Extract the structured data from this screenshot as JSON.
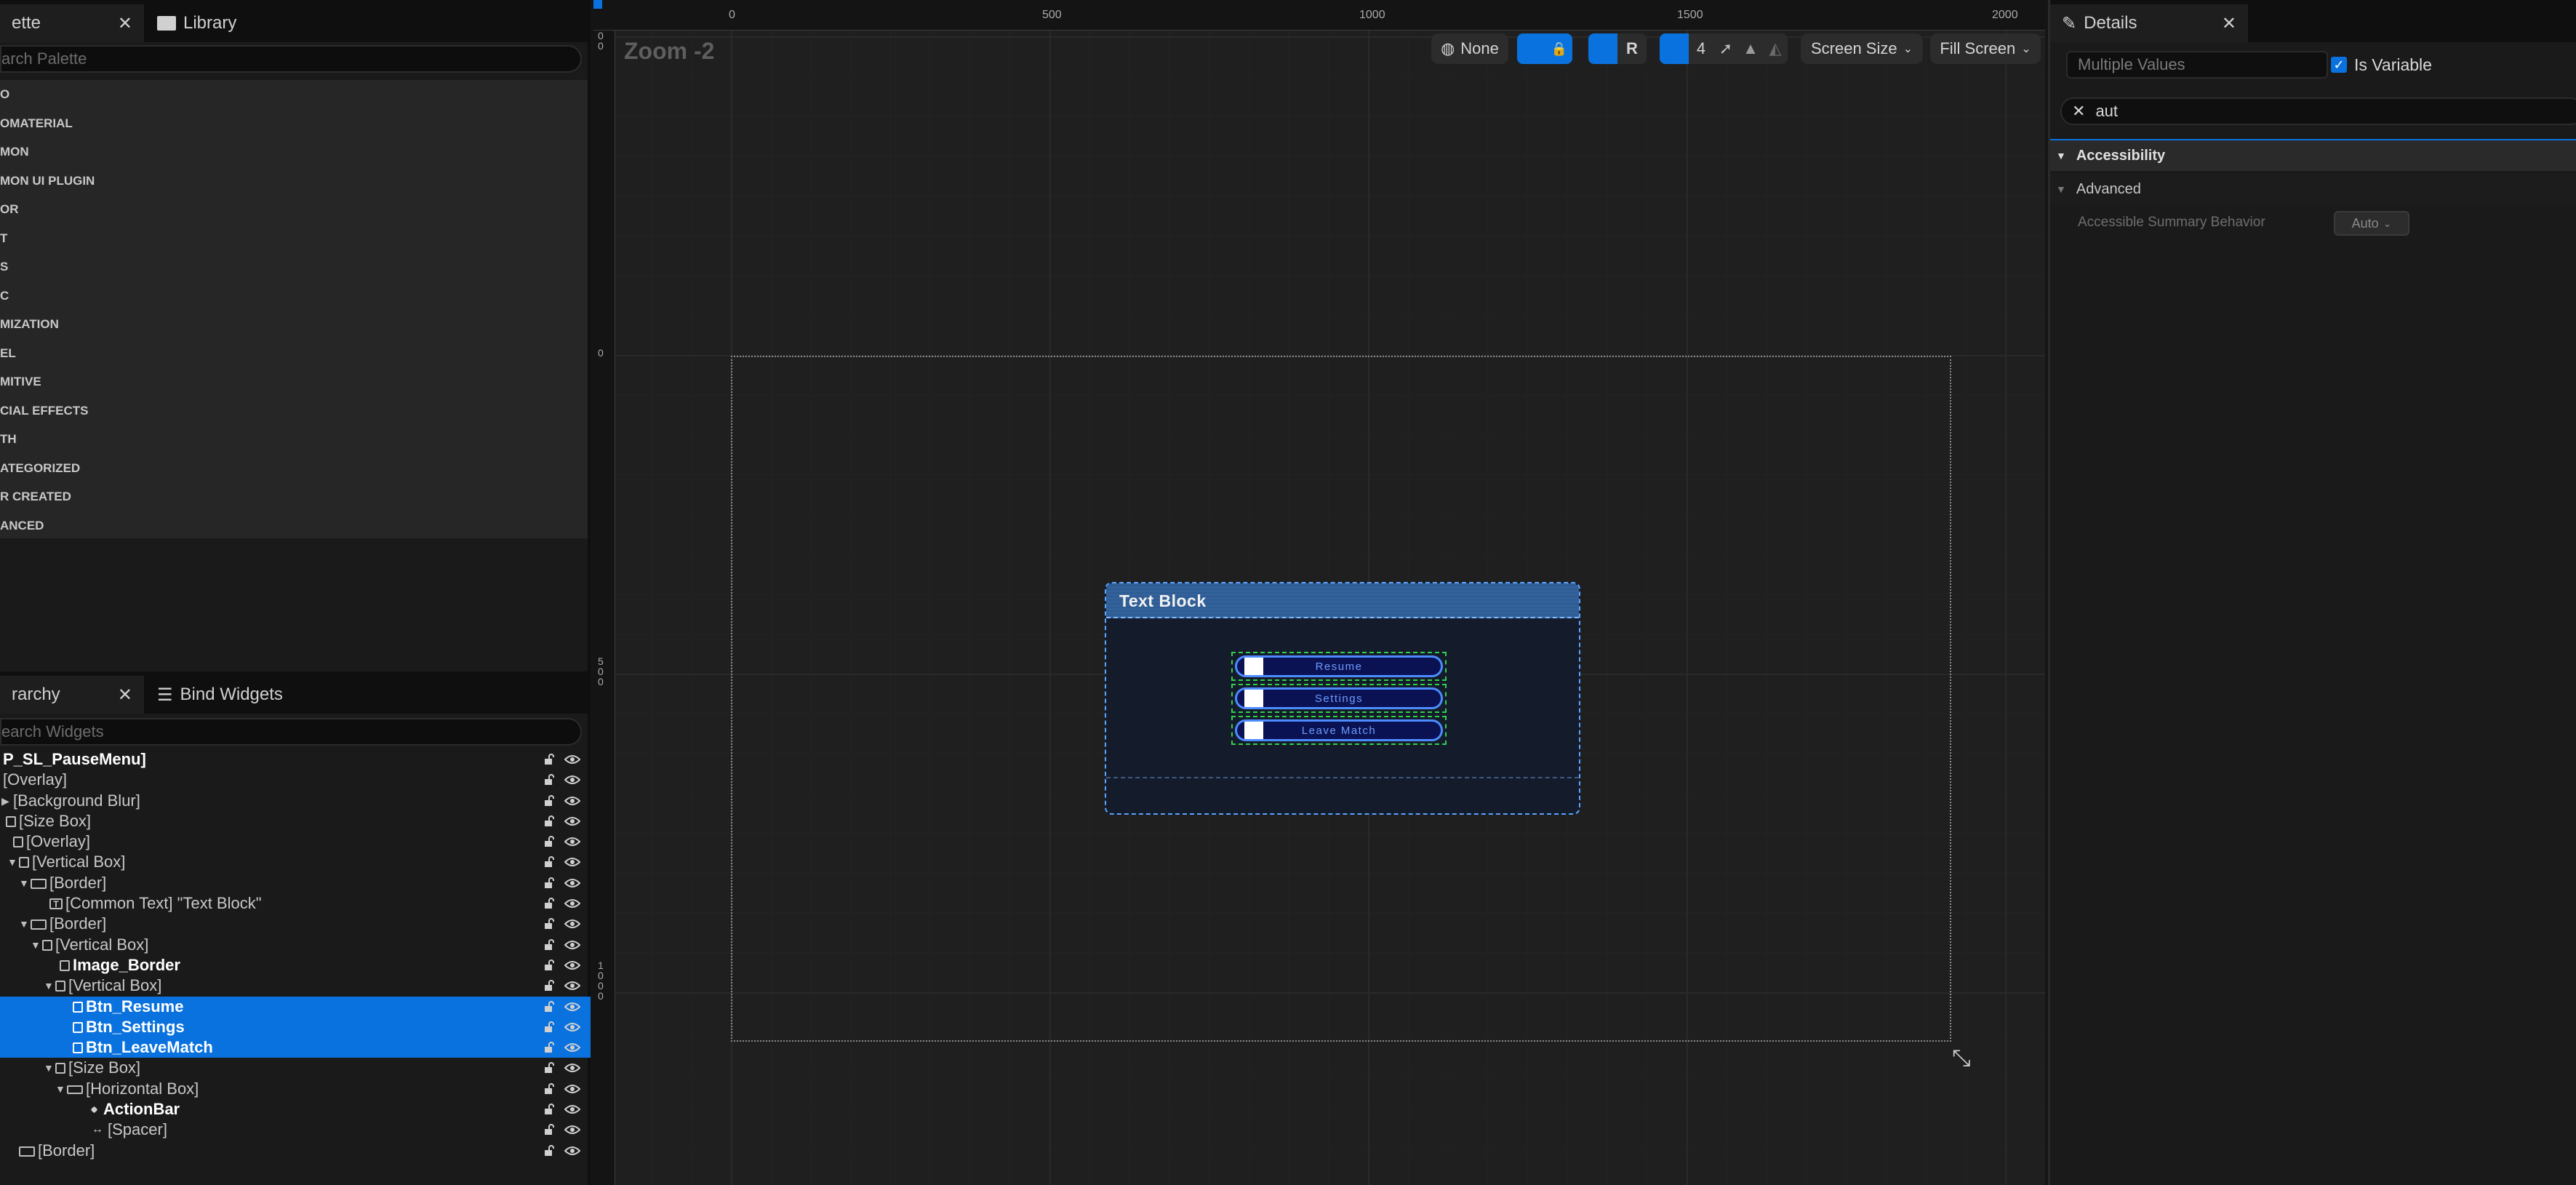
{
  "palette": {
    "tab_label": "ette",
    "library_tab_label": "Library",
    "search_placeholder": "arch Palette",
    "categories": [
      "O",
      "OMATERIAL",
      "MON",
      "MON UI PLUGIN",
      "OR",
      "T",
      "S",
      "C",
      "MIZATION",
      "EL",
      "MITIVE",
      "CIAL EFFECTS",
      "TH",
      "ATEGORIZED",
      "R CREATED",
      "ANCED"
    ]
  },
  "hierarchy": {
    "tab_label": "rarchy",
    "bind_tab_label": "Bind Widgets",
    "search_placeholder": "earch Widgets",
    "rows": [
      {
        "label": "P_SL_PauseMenu]",
        "selected": false
      },
      {
        "label": "[Overlay]",
        "selected": false
      },
      {
        "label": "[Background Blur]",
        "selected": false
      },
      {
        "label": "[Size Box]",
        "selected": false
      },
      {
        "label": "[Overlay]",
        "selected": false
      },
      {
        "label": "[Vertical Box]",
        "selected": false
      },
      {
        "label": "[Border]",
        "selected": false
      },
      {
        "label": "[Common Text] \"Text Block\"",
        "selected": false
      },
      {
        "label": "[Border]",
        "selected": false
      },
      {
        "label": "[Vertical Box]",
        "selected": false
      },
      {
        "label": "Image_Border",
        "selected": false
      },
      {
        "label": "[Vertical Box]",
        "selected": false
      },
      {
        "label": "Btn_Resume",
        "selected": true
      },
      {
        "label": "Btn_Settings",
        "selected": true
      },
      {
        "label": "Btn_LeaveMatch",
        "selected": true
      },
      {
        "label": "[Size Box]",
        "selected": false
      },
      {
        "label": "[Horizontal Box]",
        "selected": false
      },
      {
        "label": "ActionBar",
        "selected": false
      },
      {
        "label": "[Spacer]",
        "selected": false
      },
      {
        "label": "[Border]",
        "selected": false
      }
    ]
  },
  "canvas": {
    "zoom_label": "Zoom -2",
    "ruler_top": [
      "0",
      "500",
      "1000",
      "1500",
      "2000"
    ],
    "ruler_left": [
      "0\n0",
      "0",
      "5\n0\n0",
      "1\n0\n0\n0"
    ],
    "toolbar": {
      "locale": "None",
      "r_button": "R",
      "grid_snap": "4",
      "screen_size": "Screen Size",
      "fill_screen": "Fill Screen"
    },
    "menu": {
      "title": "Text Block",
      "buttons": [
        "Resume",
        "Settings",
        "Leave Match"
      ]
    }
  },
  "details": {
    "tab_label": "Details",
    "name_placeholder": "Multiple Values",
    "is_variable_label": "Is Variable",
    "is_variable_checked": true,
    "search_value": "aut",
    "category": "Accessibility",
    "subcategory": "Advanced",
    "property_label": "Accessible Summary Behavior",
    "property_value": "Auto"
  },
  "colors": {
    "accent": "#0a72de",
    "selection_outline": "#2fd14a",
    "menu_header": "#2f5d96",
    "button_fill": "#0b1253"
  }
}
